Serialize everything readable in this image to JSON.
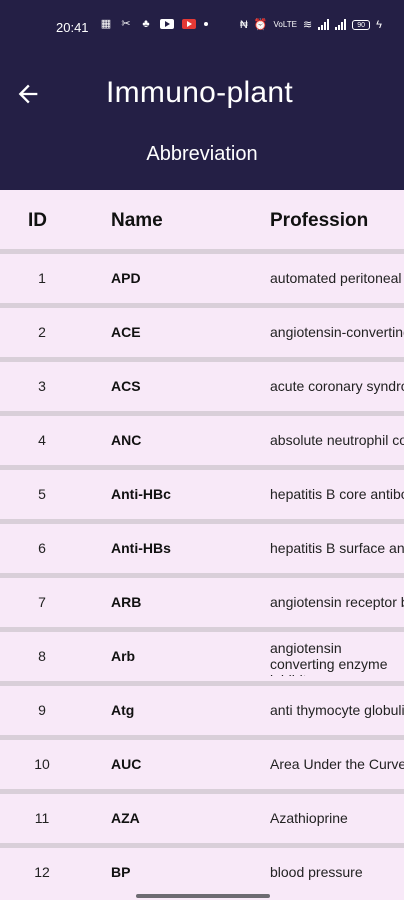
{
  "status_bar": {
    "time": "20:41",
    "battery": "90"
  },
  "app_bar": {
    "title": "Immuno-plant",
    "subtitle": "Abbreviation"
  },
  "table": {
    "headers": {
      "id": "ID",
      "name": "Name",
      "profession": "Profession"
    },
    "rows": [
      {
        "id": "1",
        "name": "APD",
        "profession": "automated peritoneal dialysis"
      },
      {
        "id": "2",
        "name": "ACE",
        "profession": "angiotensin-converting enzyme"
      },
      {
        "id": "3",
        "name": "ACS",
        "profession": "acute coronary syndrome"
      },
      {
        "id": "4",
        "name": "ANC",
        "profession": "absolute neutrophil count"
      },
      {
        "id": "5",
        "name": "Anti-HBc",
        "profession": "hepatitis B core antibody"
      },
      {
        "id": "6",
        "name": "Anti-HBs",
        "profession": "hepatitis B surface antibody"
      },
      {
        "id": "7",
        "name": "ARB",
        "profession": "angiotensin receptor blocker"
      },
      {
        "id": "8",
        "name": "Arb",
        "profession": "angiotensin converting enzyme inhibitor"
      },
      {
        "id": "9",
        "name": "Atg",
        "profession": "anti thymocyte globulin"
      },
      {
        "id": "10",
        "name": "AUC",
        "profession": "Area Under the Curve"
      },
      {
        "id": "11",
        "name": "AZA",
        "profession": "Azathioprine"
      },
      {
        "id": "12",
        "name": "BP",
        "profession": "blood pressure"
      }
    ]
  },
  "colors": {
    "app_bar": "#241f45",
    "background": "#f8e9f8",
    "divider": "#d9cfd9"
  }
}
